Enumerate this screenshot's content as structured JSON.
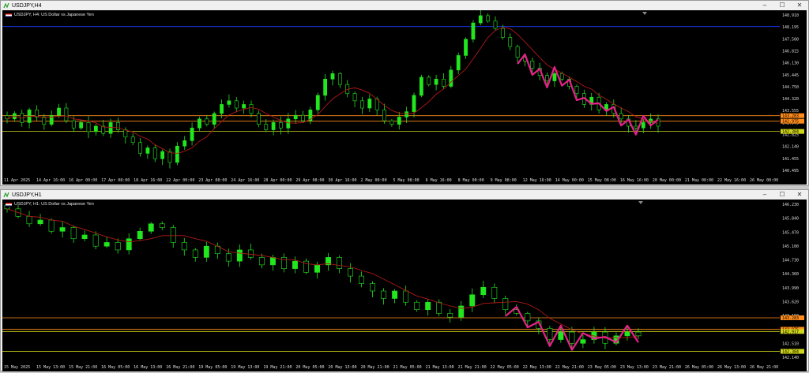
{
  "windows": [
    {
      "title": "USDJPY,H4",
      "symbol_label": "USDJPY, H4:  US Dollar vs Japanese Yen",
      "chart_data": {
        "type": "candlestick",
        "symbol": "USDJPY",
        "timeframe": "H4",
        "description": "US Dollar vs Japanese Yen",
        "y_ticks": [
          "148.910",
          "148.195",
          "147.500",
          "146.815",
          "146.130",
          "145.445",
          "144.750",
          "144.320",
          "143.555",
          "142.975",
          "142.825",
          "142.140",
          "141.455",
          "140.495"
        ],
        "ylim": [
          140.0,
          149.1
        ],
        "x_ticks": [
          "11 Apr 2025",
          "14 Apr 16:00",
          "16 Apr 00:00",
          "17 Apr 08:00",
          "18 Apr 16:00",
          "22 Apr 00:00",
          "23 Apr 08:00",
          "24 Apr 16:00",
          "28 Apr 00:00",
          "29 Apr 08:00",
          "30 Apr 16:00",
          "2 May 00:00",
          "5 May 08:00",
          "6 May 16:00",
          "8 May 00:00",
          "9 May 08:00",
          "12 May 16:00",
          "14 May 00:00",
          "15 May 08:00",
          "16 May 16:00",
          "20 May 00:00",
          "21 May 08:00",
          "22 May 16:00",
          "26 May 00:00"
        ],
        "hlines": [
          {
            "price": 148.2,
            "color": "#1e3cff",
            "label": ""
          },
          {
            "price": 143.28,
            "color": "#ff8c1a",
            "label": "143.283"
          },
          {
            "price": 142.975,
            "color": "#ff8c1a",
            "label": "142.975"
          },
          {
            "price": 142.41,
            "color": "#cfd51a",
            "label": "142.384"
          }
        ],
        "closes": [
          143.1,
          143.4,
          142.9,
          143.6,
          143.2,
          142.8,
          143.3,
          143.7,
          143.0,
          142.6,
          142.9,
          142.4,
          142.7,
          142.3,
          142.9,
          142.5,
          142.1,
          141.8,
          141.2,
          141.5,
          140.9,
          141.3,
          140.7,
          141.6,
          141.9,
          142.6,
          143.1,
          142.8,
          143.4,
          143.9,
          144.1,
          143.7,
          143.9,
          143.4,
          142.8,
          142.5,
          142.9,
          142.6,
          143.1,
          143.3,
          143.0,
          143.6,
          144.4,
          145.3,
          145.6,
          145.0,
          144.5,
          144.1,
          143.7,
          144.2,
          143.6,
          143.0,
          142.8,
          143.2,
          143.5,
          144.4,
          145.4,
          145.0,
          145.3,
          144.9,
          145.8,
          146.6,
          147.5,
          148.4,
          148.8,
          148.5,
          148.1,
          147.6,
          147.1,
          146.5,
          146.3,
          145.9,
          145.5,
          145.2,
          145.6,
          145.3,
          144.9,
          144.5,
          143.9,
          144.3,
          143.6,
          143.9,
          143.4,
          143.1,
          142.7,
          142.6,
          142.9,
          143.1,
          142.7
        ],
        "ma_color": "#b01818",
        "annotation_color": "#e8208a"
      }
    },
    {
      "title": "USDJPY,H1",
      "symbol_label": "USDJPY, H1:  US Dollar vs Japanese Yen",
      "chart_data": {
        "type": "candlestick",
        "symbol": "USDJPY",
        "timeframe": "H1",
        "description": "US Dollar vs Japanese Yen",
        "y_ticks": [
          "146.230",
          "145.840",
          "145.470",
          "145.100",
          "144.730",
          "144.360",
          "143.990",
          "143.620",
          "143.150",
          "142.880",
          "142.510",
          "142.140"
        ],
        "ylim": [
          142.1,
          146.45
        ],
        "x_ticks": [
          "15 May 2025",
          "15 May 13:00",
          "15 May 21:00",
          "16 May 05:00",
          "16 May 13:00",
          "16 May 21:00",
          "19 May 05:00",
          "19 May 13:00",
          "19 May 21:00",
          "20 May 05:00",
          "20 May 13:00",
          "20 May 21:00",
          "21 May 05:00",
          "21 May 13:00",
          "21 May 21:00",
          "22 May 05:00",
          "22 May 13:00",
          "22 May 21:00",
          "23 May 05:00",
          "23 May 13:00",
          "23 May 21:00",
          "26 May 05:00",
          "26 May 13:00",
          "26 May 21:00"
        ],
        "hlines": [
          {
            "price": 143.283,
            "color": "#ff8c1a",
            "label": "143.283"
          },
          {
            "price": 142.975,
            "color": "#ff8c1a",
            "label": "142.975"
          },
          {
            "price": 142.917,
            "color": "#cfd51a",
            "label": "142.917"
          },
          {
            "price": 142.384,
            "color": "#cfd51a",
            "label": "142.384"
          }
        ],
        "closes": [
          146.2,
          146.0,
          145.8,
          145.9,
          145.6,
          145.7,
          145.4,
          145.5,
          145.2,
          145.3,
          145.1,
          145.4,
          145.6,
          145.8,
          145.7,
          145.3,
          145.1,
          144.9,
          145.2,
          145.0,
          144.8,
          145.1,
          144.9,
          144.7,
          144.9,
          144.6,
          144.8,
          144.5,
          144.7,
          144.9,
          144.6,
          144.4,
          144.2,
          144.0,
          143.8,
          144.0,
          143.7,
          143.5,
          143.7,
          143.4,
          143.3,
          143.6,
          143.9,
          144.1,
          143.8,
          143.5,
          143.4,
          143.2,
          143.0,
          142.7,
          142.9,
          142.6,
          142.7,
          142.9,
          142.6,
          142.8,
          142.9,
          142.8
        ],
        "ma_color": "#b01818",
        "annotation_color": "#e8208a"
      }
    }
  ],
  "window_controls": {
    "minimize": "–",
    "maximize": "☐",
    "close": "✕"
  },
  "colors": {
    "candle": "#22e61e",
    "background": "#000000",
    "axis_text": "#dddddd"
  }
}
